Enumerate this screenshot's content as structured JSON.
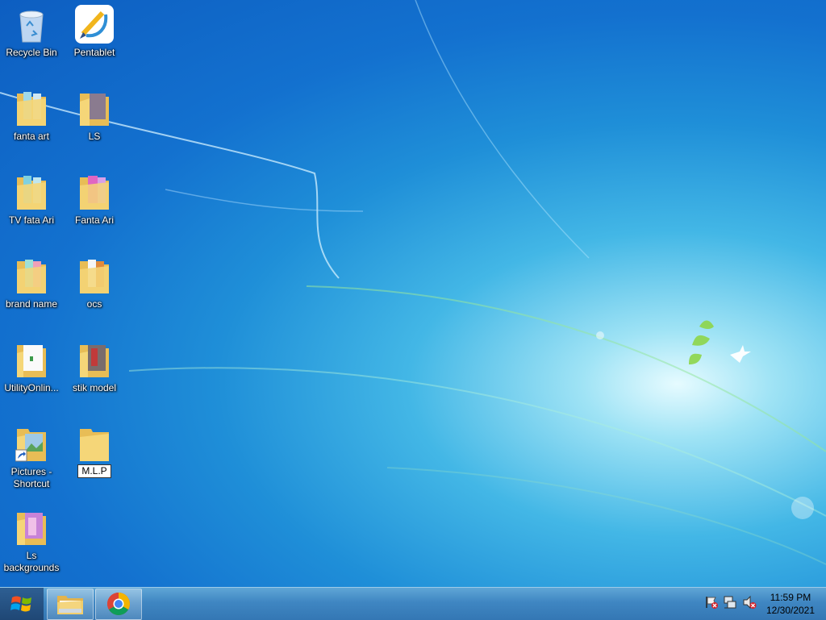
{
  "desktop": {
    "icons": [
      {
        "label": "Recycle Bin",
        "icon": "recycle-bin-icon"
      },
      {
        "label": "Pentablet",
        "icon": "pentablet-app-icon"
      },
      {
        "label": "fanta art",
        "icon": "folder-icon"
      },
      {
        "label": "LS",
        "icon": "folder-icon"
      },
      {
        "label": "TV  fata Ari",
        "icon": "folder-icon"
      },
      {
        "label": "Fanta Ari",
        "icon": "folder-icon"
      },
      {
        "label": "brand name",
        "icon": "folder-icon"
      },
      {
        "label": "ocs",
        "icon": "folder-icon"
      },
      {
        "label": "UtilityOnlin...",
        "icon": "folder-icon"
      },
      {
        "label": "stik  model",
        "icon": "folder-icon"
      },
      {
        "label": "Pictures - Shortcut",
        "icon": "folder-shortcut-icon"
      },
      {
        "label": "M.L.P",
        "icon": "folder-icon",
        "renaming": true
      },
      {
        "label": "Ls backgrounds",
        "icon": "folder-icon"
      }
    ]
  },
  "taskbar": {
    "start_icon": "windows-logo-icon",
    "pinned": [
      {
        "name": "file-explorer",
        "icon": "file-explorer-icon"
      },
      {
        "name": "chrome",
        "icon": "chrome-icon"
      }
    ],
    "tray": {
      "icons": [
        "action-center-flag-icon",
        "network-icon",
        "volume-muted-icon"
      ],
      "time": "11:59 PM",
      "date": "12/30/2021"
    }
  },
  "colors": {
    "wallpaper_accent": "#1f8fd8",
    "folder": "#f2cf6e",
    "taskbar": "#3f86c2"
  }
}
